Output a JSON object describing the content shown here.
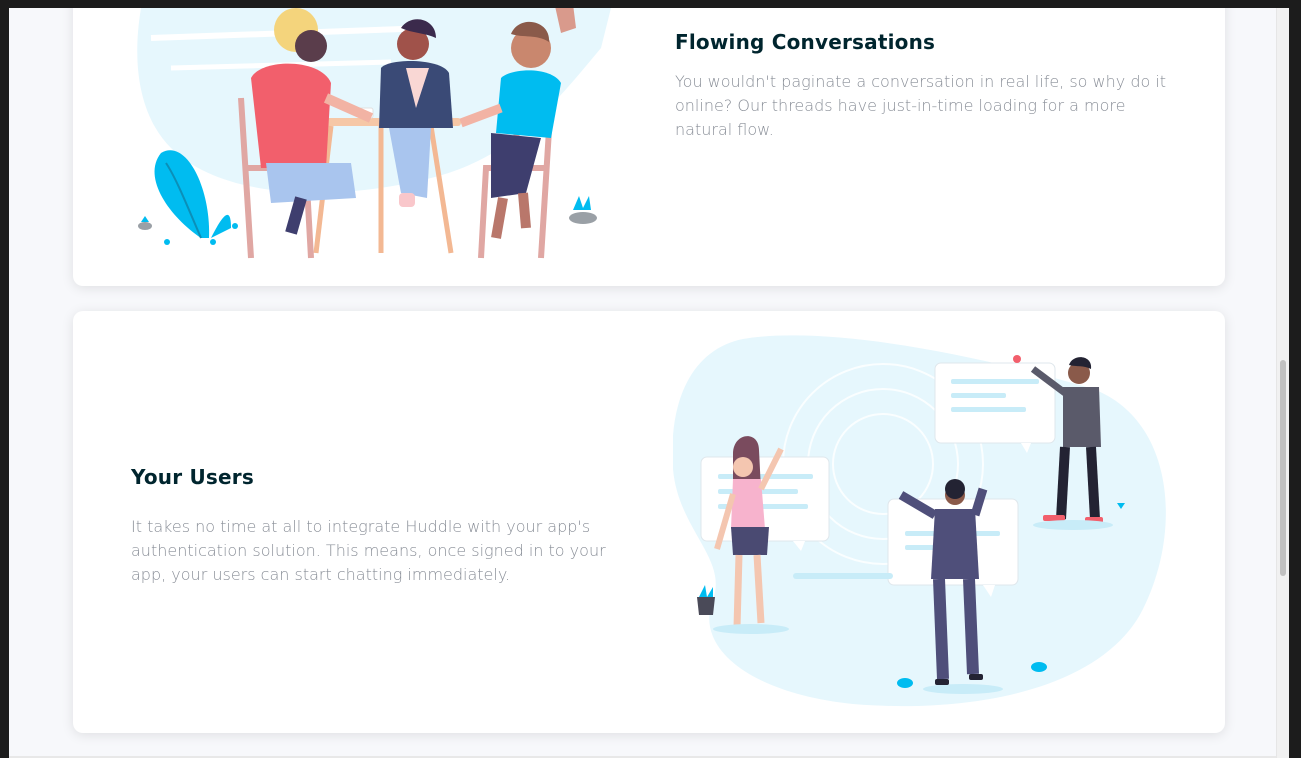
{
  "features": {
    "flowing": {
      "title": "Flowing Conversations",
      "text": "You wouldn't paginate a conversation in real life, so why do it online? Our threads have just-in-time loading for a more natural flow.",
      "illustration_icon": "people-at-table-illustration"
    },
    "users": {
      "title": "Your Users",
      "text": "It takes no time at all to integrate Huddle with your app's authentication solution. This means, once signed in to your app, your users can start chatting immediately.",
      "illustration_icon": "people-with-chat-bubbles-illustration"
    }
  },
  "colors": {
    "page_background": "#f7f8fb",
    "card_background": "#ffffff",
    "title": "#00252e",
    "body_text": "#8a8f98",
    "accent_cyan": "#00bcf0",
    "light_blob": "#e6f7fd"
  }
}
